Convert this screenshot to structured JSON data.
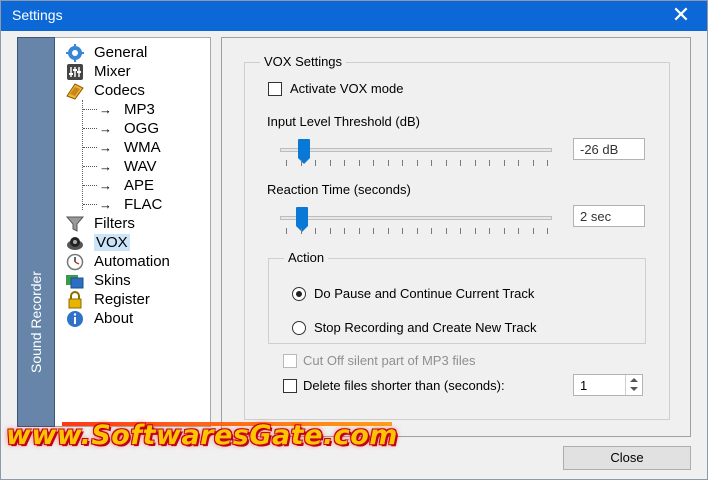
{
  "window": {
    "title": "Settings"
  },
  "sidebar": {
    "vertical_label": "Sound Recorder"
  },
  "tree": {
    "items": [
      {
        "label": "General",
        "icon": "gear-icon"
      },
      {
        "label": "Mixer",
        "icon": "mixer-icon"
      },
      {
        "label": "Codecs",
        "icon": "codecs-icon"
      },
      {
        "label": "MP3"
      },
      {
        "label": "OGG"
      },
      {
        "label": "WMA"
      },
      {
        "label": "WAV"
      },
      {
        "label": "APE"
      },
      {
        "label": "FLAC"
      },
      {
        "label": "Filters",
        "icon": "funnel-icon"
      },
      {
        "label": "VOX",
        "icon": "vox-icon",
        "selected": true
      },
      {
        "label": "Automation",
        "icon": "clock-icon"
      },
      {
        "label": "Skins",
        "icon": "skins-icon"
      },
      {
        "label": "Register",
        "icon": "lock-icon"
      },
      {
        "label": "About",
        "icon": "info-icon"
      }
    ]
  },
  "vox": {
    "group_title": "VOX Settings",
    "activate_label": "Activate VOX mode",
    "activate_checked": false,
    "threshold_label": "Input Level Threshold (dB)",
    "threshold_value": "-26 dB",
    "threshold_position": 0.07,
    "reaction_label": "Reaction Time (seconds)",
    "reaction_value": "2 sec",
    "reaction_position": 0.06,
    "action_title": "Action",
    "action_options": [
      {
        "label": "Do Pause and Continue Current Track",
        "checked": true
      },
      {
        "label": "Stop Recording and Create New Track",
        "checked": false
      }
    ],
    "cutoff_label": "Cut Off silent part of MP3 files",
    "delete_label": "Delete files shorter than (seconds):",
    "delete_value": "1"
  },
  "footer": {
    "close_label": "Close"
  },
  "watermark": {
    "text": "www.SoftwaresGate.com"
  },
  "colors": {
    "titlebar": "#0c68d6",
    "accent": "#0a78d7",
    "watermark": "#ffc400"
  }
}
